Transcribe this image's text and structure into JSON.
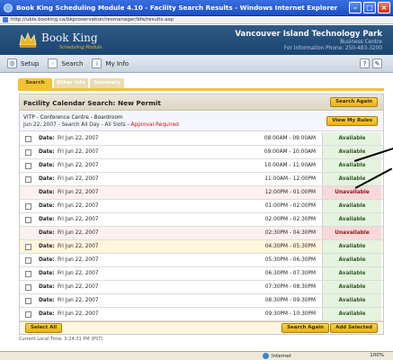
{
  "window": {
    "title": "Book King Scheduling Module 4.10 - Facility Search Results - Windows Internet Explorer",
    "address": "http://ukts.booking.ca/bkproservation/resmanager/bfe/results.asp"
  },
  "header": {
    "brand": "Book King",
    "brand_sub": "Scheduling Module",
    "org": "Vancouver Island Technology Park",
    "org_sub1": "Business Centre",
    "org_sub2": "For Information Phone: 250-483-3200"
  },
  "nav": {
    "items": [
      {
        "label": "Setup",
        "icon": "setup-icon"
      },
      {
        "label": "Search",
        "icon": "search-icon"
      },
      {
        "label": "My Info",
        "icon": "info-icon"
      }
    ]
  },
  "tabs": [
    "Search",
    "Other Info",
    "Summary"
  ],
  "card": {
    "title": "Facility Calendar Search: New Permit",
    "search_again_top": "Search Again",
    "facility": "VITP - Conference Centre - Boardroom",
    "details": "Jun 22, 2007 - Search All Day - All Slots - ",
    "approval": "Approval Required",
    "view_rules": "View My Rules"
  },
  "rows": [
    {
      "label": "Date:",
      "date": "Fri Jun 22, 2007",
      "time": "08:00AM - 09:00AM",
      "status": "Available",
      "available": true
    },
    {
      "label": "Date:",
      "date": "Fri Jun 22, 2007",
      "time": "09:00AM - 10:00AM",
      "status": "Available",
      "available": true
    },
    {
      "label": "Date:",
      "date": "Fri Jun 22, 2007",
      "time": "10:00AM - 11:00AM",
      "status": "Available",
      "available": true
    },
    {
      "label": "Date:",
      "date": "Fri Jun 22, 2007",
      "time": "11:00AM - 12:00PM",
      "status": "Available",
      "available": true
    },
    {
      "label": "Date:",
      "date": "Fri Jun 22, 2007",
      "time": "12:00PM - 01:00PM",
      "status": "Unavailable",
      "available": false
    },
    {
      "label": "Date:",
      "date": "Fri Jun 22, 2007",
      "time": "01:00PM - 02:00PM",
      "status": "Available",
      "available": true
    },
    {
      "label": "Date:",
      "date": "Fri Jun 22, 2007",
      "time": "02:00PM - 02:30PM",
      "status": "Available",
      "available": true
    },
    {
      "label": "Date:",
      "date": "Fri Jun 22, 2007",
      "time": "02:30PM - 04:30PM",
      "status": "Unavailable",
      "available": false
    },
    {
      "label": "Date:",
      "date": "Fri Jun 22, 2007",
      "time": "04:30PM - 05:30PM",
      "status": "Available",
      "available": true
    },
    {
      "label": "Date:",
      "date": "Fri Jun 22, 2007",
      "time": "05:30PM - 06:30PM",
      "status": "Available",
      "available": true
    },
    {
      "label": "Date:",
      "date": "Fri Jun 22, 2007",
      "time": "06:30PM - 07:30PM",
      "status": "Available",
      "available": true
    },
    {
      "label": "Date:",
      "date": "Fri Jun 22, 2007",
      "time": "07:30PM - 08:30PM",
      "status": "Available",
      "available": true
    },
    {
      "label": "Date:",
      "date": "Fri Jun 22, 2007",
      "time": "08:30PM - 09:30PM",
      "status": "Available",
      "available": true
    },
    {
      "label": "Date:",
      "date": "Fri Jun 22, 2007",
      "time": "09:30PM - 10:30PM",
      "status": "Available",
      "available": true
    }
  ],
  "footer": {
    "select_all": "Select All",
    "search_again": "Search Again",
    "add_selected": "Add Selected"
  },
  "local_time": "Current Local Time: 3:24:31 PM (PST)",
  "statusbar": {
    "zone": "Internet",
    "zoom": "100%"
  },
  "colors": {
    "accent": "#f2c334",
    "header": "#1c4470",
    "available": "#e5f3df",
    "unavailable": "#f8d8d8"
  }
}
